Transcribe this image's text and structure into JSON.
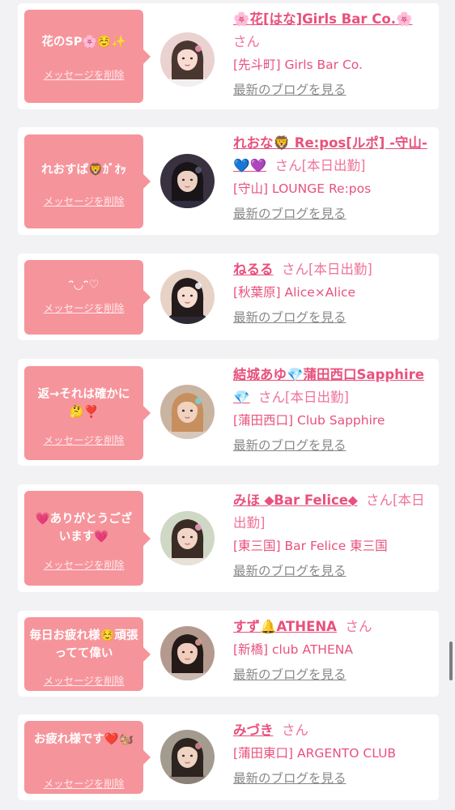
{
  "cards": [
    {
      "message": "花のSP🌸☺️✨",
      "delete_label": "メッセージを削除",
      "name": "🌸花[はな]Girls Bar Co.🌸",
      "suffix": "さん",
      "shop": "[先斗町] Girls Bar Co.",
      "blog_label": "最新のブログを見る",
      "avatar": {
        "bg": "#e9d2cf",
        "hair": "#4a3630",
        "skin": "#f8dcd2",
        "accent": "#f39bb7",
        "clothes": "#f2f0ee"
      }
    },
    {
      "message": "れおすぱ🦁ｶﾞｵｯ",
      "delete_label": "メッセージを削除",
      "name": "れおな🦁 Re:pos[ルポ] -守山-💙💜",
      "suffix": "さん[本日出勤]",
      "shop": "[守山] LOUNGE Re:pos",
      "blog_label": "最新のブログを見る",
      "avatar": {
        "bg": "#3a3140",
        "hair": "#181418",
        "skin": "#ecd1c3",
        "accent": "#5f5a78",
        "clothes": "#2f2d3f"
      }
    },
    {
      "message": "ᵔ◡ᵔ♡",
      "delete_label": "メッセージを削除",
      "name": "ねるる",
      "suffix": "さん[本日出勤]",
      "shop": "[秋葉原] Alice×Alice",
      "blog_label": "最新のブログを見る",
      "avatar": {
        "bg": "#e6d3c6",
        "hair": "#231b1b",
        "skin": "#f6ddd1",
        "accent": "#ffffff",
        "clothes": "#2e2a35"
      }
    },
    {
      "message": "返→それは確かに🤔❣️",
      "delete_label": "メッセージを削除",
      "name": "結城あゆ💎蒲田西口Sapphire💎",
      "suffix": "さん[本日出勤]",
      "shop": "[蒲田西口] Club Sapphire",
      "blog_label": "最新のブログを見る",
      "avatar": {
        "bg": "#c9b4a2",
        "hair": "#c78f5e",
        "skin": "#f0d2bf",
        "accent": "#7fd0e0",
        "clothes": "#d8c7bb"
      }
    },
    {
      "message": "💗ありがとうござ います💗",
      "delete_label": "メッセージを削除",
      "name": "みほ ⬥Bar Felice⬥",
      "suffix": "さん[本日出勤]",
      "shop": "[東三国] Bar Felice 東三国",
      "blog_label": "最新のブログを見る",
      "avatar": {
        "bg": "#cfd8c4",
        "hair": "#3a2c24",
        "skin": "#f1d6c8",
        "accent": "#f5a6cf",
        "clothes": "#e8e1da"
      }
    },
    {
      "message": "毎日お疲れ様☺️頑張ってて偉い",
      "delete_label": "メッセージを削除",
      "name": "すず🔔ATHENA",
      "suffix": "さん",
      "shop": "[新橋] club ATHENA",
      "blog_label": "最新のブログを見る",
      "avatar": {
        "bg": "#b49a8e",
        "hair": "#241a18",
        "skin": "#f0cdbd",
        "accent": "#e6a29b",
        "clothes": "#cbbab0"
      }
    },
    {
      "message": "お疲れ様です❤️🐿️",
      "delete_label": "メッセージを削除",
      "name": "みづき",
      "suffix": "さん",
      "shop": "[蒲田東口] ARGENTO CLUB",
      "blog_label": "最新のブログを見る",
      "avatar": {
        "bg": "#a39a90",
        "hair": "#2d231f",
        "skin": "#efd3c3",
        "accent": "#d98c90",
        "clothes": "#8c8079"
      }
    }
  ],
  "colors": {
    "bubble": "#f6949b",
    "name": "#e8517d",
    "muted": "#888888"
  }
}
